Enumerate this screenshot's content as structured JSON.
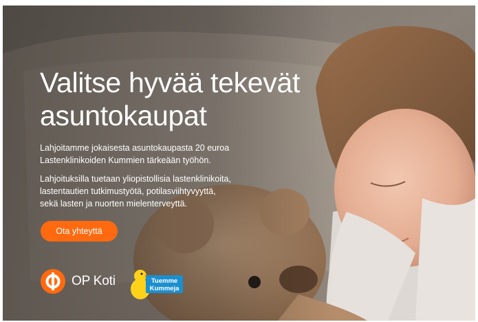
{
  "banner": {
    "headline_line1": "Valitse hyvää tekevät",
    "headline_line2": "asuntokaupat",
    "paragraph1_line1": "Lahjoitamme jokaisesta asuntokaupasta 20 euroa",
    "paragraph1_line2": "Lastenklinikoiden Kummien tärkeään työhön.",
    "paragraph2_line1": "Lahjoituksilla tuetaan yliopistollisia lastenklinikoita,",
    "paragraph2_line2": "lastentautien tutkimustyötä, potilasviihtyvyyttä,",
    "paragraph2_line3": "sekä lasten ja nuorten mielenterveyttä.",
    "cta_label": "Ota yhteyttä"
  },
  "logos": {
    "op_koti_text": "OP Koti",
    "tuemme_line1": "Tuemme",
    "tuemme_line2": "Kummeja"
  },
  "colors": {
    "accent_orange": "#ff6a10",
    "text": "#ffffff",
    "tuemme_blue": "#1b8fd0",
    "duck_yellow": "#ffd21a"
  }
}
